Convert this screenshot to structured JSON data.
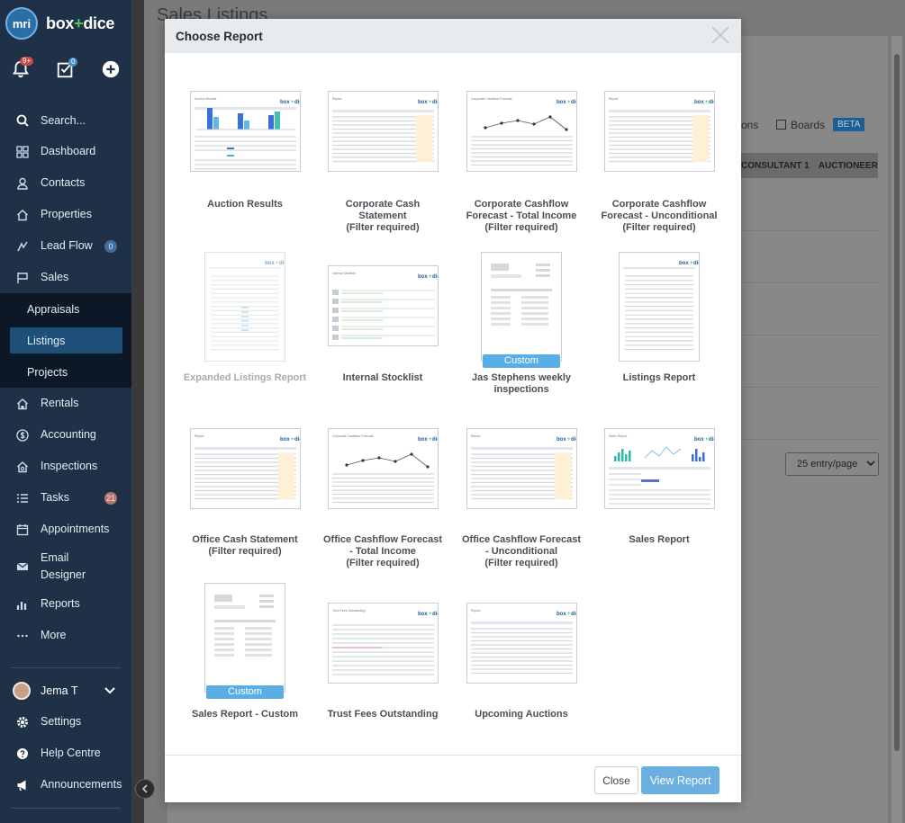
{
  "app": {
    "brand_left": "box",
    "brand_plus": "+",
    "brand_right": "dice",
    "logo_text": "mri",
    "notifications_badge": "9+",
    "tasks_badge": "0"
  },
  "sidebar": {
    "search_label": "Search...",
    "items": [
      {
        "label": "Dashboard",
        "icon": "grid-icon"
      },
      {
        "label": "Contacts",
        "icon": "person-icon"
      },
      {
        "label": "Properties",
        "icon": "house-icon"
      },
      {
        "label": "Lead Flow",
        "icon": "lead-icon",
        "count": "0"
      },
      {
        "label": "Sales",
        "icon": "sale-sign-icon"
      }
    ],
    "sales_sub": [
      {
        "label": "Appraisals",
        "active": false
      },
      {
        "label": "Listings",
        "active": true
      },
      {
        "label": "Projects",
        "active": false
      }
    ],
    "items2": [
      {
        "label": "Rentals",
        "icon": "rental-house-icon"
      },
      {
        "label": "Accounting",
        "icon": "dollar-icon"
      },
      {
        "label": "Inspections",
        "icon": "inspection-icon"
      },
      {
        "label": "Tasks",
        "icon": "tasks-icon",
        "count": "21"
      },
      {
        "label": "Appointments",
        "icon": "calendar-icon"
      },
      {
        "label": "Email\nDesigner",
        "icon": "mail-icon"
      },
      {
        "label": "Reports",
        "icon": "bar-chart-icon"
      },
      {
        "label": "More",
        "icon": "ellipsis-icon"
      }
    ],
    "user_name": "Jema T",
    "bottom": [
      {
        "label": "Settings",
        "icon": "gear-icon"
      },
      {
        "label": "Help Centre",
        "icon": "help-icon"
      },
      {
        "label": "Announcements",
        "icon": "megaphone-icon"
      }
    ]
  },
  "background": {
    "page_title": "Sales Listings",
    "view_partial": "ons",
    "boards_label": "Boards",
    "beta_label": "BETA",
    "col_consultant": "CONSULTANT 1",
    "col_auctioneer": "AUCTIONEER",
    "per_page": "25 entry/page"
  },
  "modal": {
    "title": "Choose Report",
    "close_button": "Close",
    "view_button": "View Report",
    "custom_tag": "Custom",
    "reports": [
      {
        "label": "Auction Results",
        "disabled": false,
        "thumb": "bars"
      },
      {
        "label": "Corporate Cash\nStatement\n(Filter required)",
        "disabled": false,
        "thumb": "table"
      },
      {
        "label": "Corporate Cashflow\nForecast - Total Income\n(Filter required)",
        "disabled": false,
        "thumb": "line"
      },
      {
        "label": "Corporate Cashflow\nForecast - Unconditional\n(Filter required)",
        "disabled": false,
        "thumb": "table"
      },
      {
        "label": "Expanded Listings Report",
        "disabled": true,
        "thumb": "portrait-list"
      },
      {
        "label": "Internal Stocklist",
        "disabled": false,
        "thumb": "stock"
      },
      {
        "label": "Jas Stephens weekly\ninspections",
        "disabled": false,
        "thumb": "custom",
        "custom": true
      },
      {
        "label": "Listings Report",
        "disabled": false,
        "thumb": "portrait-table"
      },
      {
        "label": "Office Cash Statement\n(Filter required)",
        "disabled": false,
        "thumb": "table"
      },
      {
        "label": "Office Cashflow Forecast\n- Total Income\n(Filter required)",
        "disabled": false,
        "thumb": "line"
      },
      {
        "label": "Office Cashflow Forecast\n- Unconditional\n(Filter required)",
        "disabled": false,
        "thumb": "table"
      },
      {
        "label": "Sales Report",
        "disabled": false,
        "thumb": "sales"
      },
      {
        "label": "Sales Report - Custom",
        "disabled": false,
        "thumb": "custom",
        "custom": true
      },
      {
        "label": "Trust Fees Outstanding",
        "disabled": false,
        "thumb": "trust"
      },
      {
        "label": "Upcoming Auctions",
        "disabled": false,
        "thumb": "table2"
      }
    ]
  }
}
